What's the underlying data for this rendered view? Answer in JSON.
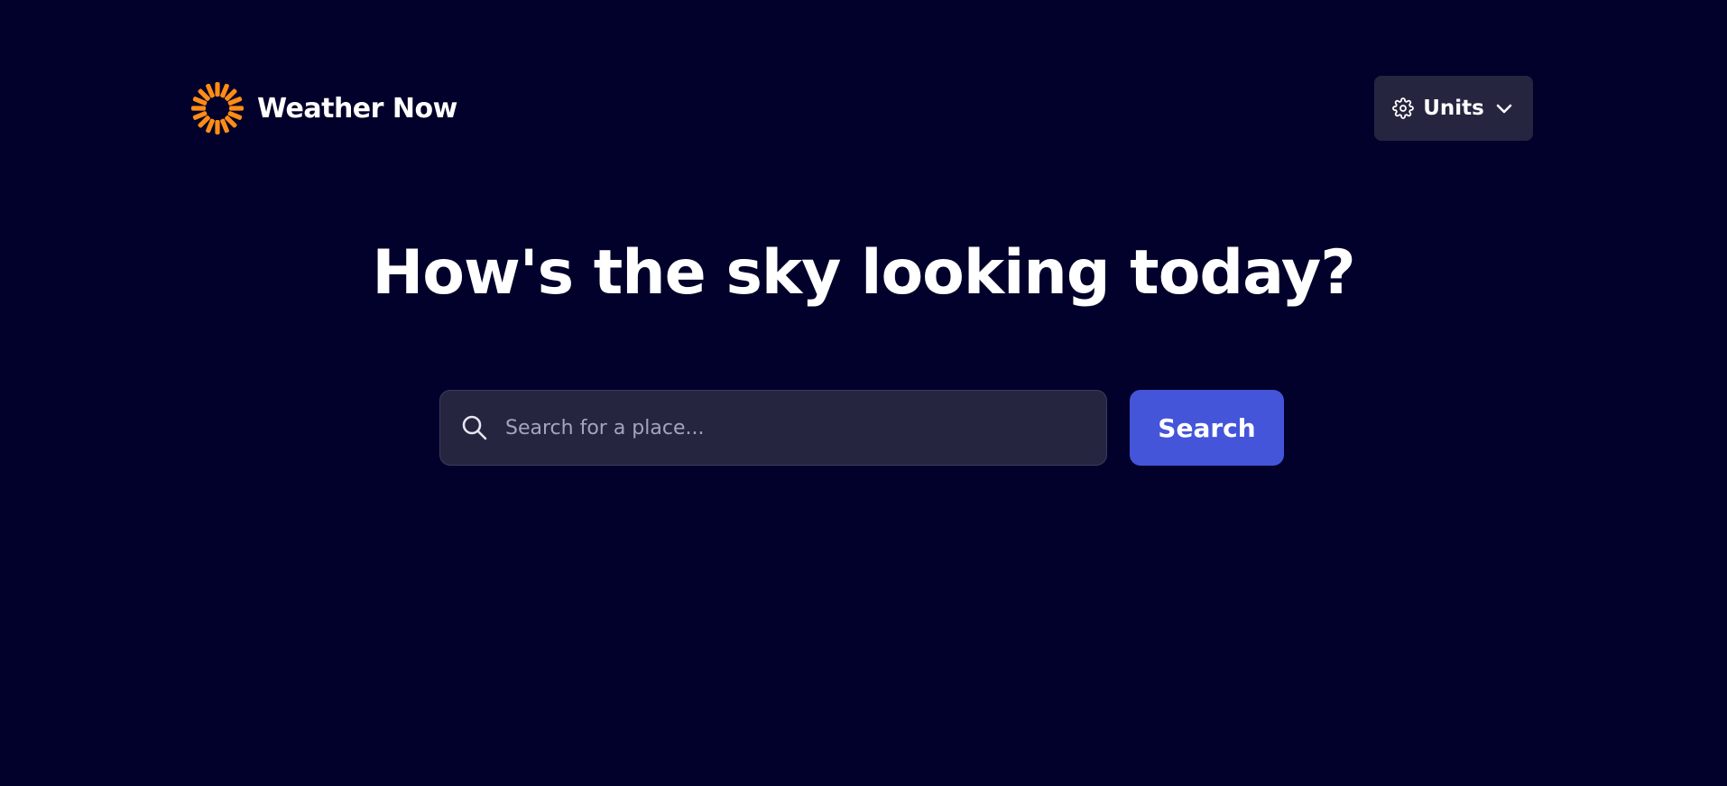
{
  "header": {
    "logo_text": "Weather Now",
    "units_button_label": "Units",
    "logo_icon": "sun-icon",
    "units_icon": "gear-icon",
    "units_chevron_icon": "chevron-down-icon"
  },
  "hero": {
    "headline": "How's the sky looking today?"
  },
  "search": {
    "placeholder": "Search for a place...",
    "value": "",
    "button_label": "Search",
    "icon": "search-icon"
  },
  "colors": {
    "background": "#02012b",
    "surface": "#262540",
    "accent": "#4455da",
    "logo_orange": "#ff8c14",
    "text": "#ffffff",
    "placeholder": "#a5a4bd"
  }
}
